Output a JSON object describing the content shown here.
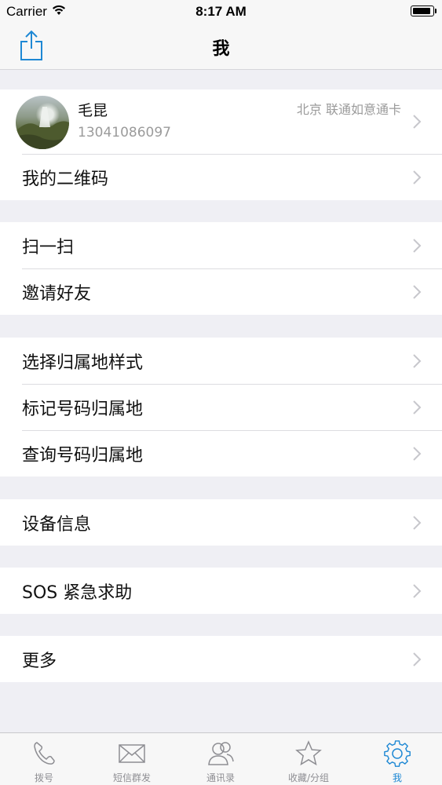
{
  "status_bar": {
    "carrier": "Carrier",
    "time": "8:17 AM"
  },
  "nav": {
    "title": "我"
  },
  "profile": {
    "name": "毛昆",
    "phone": "13041086097",
    "location": "北京 联通如意通卡"
  },
  "groups": {
    "g1": {
      "qrcode": "我的二维码"
    },
    "g2": {
      "scan": "扫一扫",
      "invite": "邀请好友"
    },
    "g3": {
      "style": "选择归属地样式",
      "mark": "标记号码归属地",
      "query": "查询号码归属地"
    },
    "g4": {
      "device": "设备信息"
    },
    "g5": {
      "sos": "SOS 紧急求助"
    },
    "g6": {
      "more": "更多"
    }
  },
  "tabs": [
    {
      "label": "拨号",
      "icon": "phone-icon"
    },
    {
      "label": "短信群发",
      "icon": "envelope-icon"
    },
    {
      "label": "通讯录",
      "icon": "contacts-icon"
    },
    {
      "label": "收藏/分组",
      "icon": "star-icon"
    },
    {
      "label": "我",
      "icon": "gear-icon"
    }
  ],
  "colors": {
    "accent": "#1e88d4",
    "background": "#efeff4",
    "secondary_text": "#9b9b9b"
  }
}
